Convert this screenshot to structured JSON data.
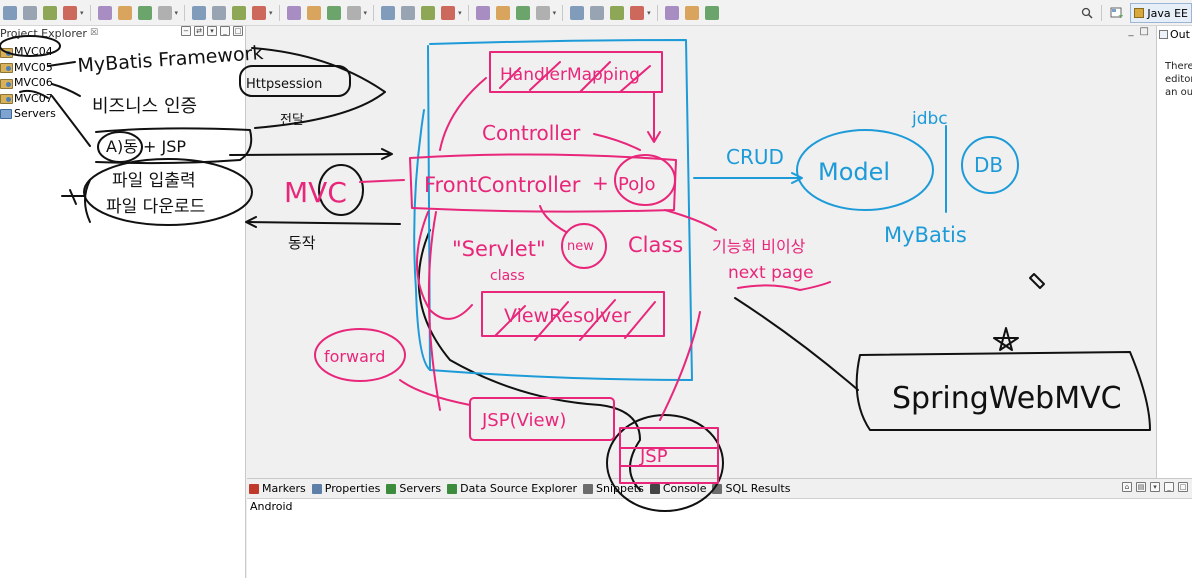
{
  "toolbar": {
    "icons": [
      "new-icon",
      "save-icon",
      "save-all-icon",
      "print-icon",
      "skip-breakpoints-icon",
      "resume-icon",
      "suspend-icon",
      "terminate-icon",
      "disconnect-icon",
      "step-into-icon",
      "step-over-icon",
      "step-return-icon",
      "drop-to-frame-icon",
      "use-step-filters-icon",
      "debug-icon",
      "run-icon",
      "run-last-icon",
      "external-tools-icon",
      "build-icon",
      "new-server-icon",
      "new-package-icon",
      "new-class-icon",
      "open-type-icon",
      "open-task-icon",
      "search-icon",
      "search-menu-icon",
      "annotation-next-icon",
      "annotation-prev-icon",
      "back-icon",
      "forward-icon",
      "pin-editor-icon"
    ],
    "quick_access_icon": "magnifier-icon",
    "open_perspective_icon": "open-perspective-icon",
    "perspective_label": "Java EE"
  },
  "project_explorer": {
    "title": "Project Explorer",
    "close_glyph": "☒",
    "items": [
      {
        "label": "MVC04",
        "icon": "project-icon"
      },
      {
        "label": "MVC05",
        "icon": "project-icon"
      },
      {
        "label": "MVC06",
        "icon": "project-icon"
      },
      {
        "label": "MVC07",
        "icon": "project-icon"
      },
      {
        "label": "Servers",
        "icon": "servers-folder-icon"
      }
    ]
  },
  "outline": {
    "tab_label": "Out",
    "message_lines": [
      "There",
      "editor",
      "an out"
    ]
  },
  "bottom_panel": {
    "tabs": [
      {
        "label": "Markers",
        "icon": "markers-icon",
        "color": "#c0392b"
      },
      {
        "label": "Properties",
        "icon": "properties-icon",
        "color": "#5d7fa8"
      },
      {
        "label": "Servers",
        "icon": "servers-icon",
        "color": "#3d8b3d"
      },
      {
        "label": "Data Source Explorer",
        "icon": "data-source-icon",
        "color": "#3d8b3d"
      },
      {
        "label": "Snippets",
        "icon": "snippets-icon",
        "color": "#6c6c6c"
      },
      {
        "label": "Console",
        "icon": "console-icon",
        "color": "#444444"
      },
      {
        "label": "SQL Results",
        "icon": "sql-results-icon",
        "color": "#6c6c6c"
      }
    ],
    "console_label": "Android"
  },
  "annotations": {
    "black": {
      "mybatis_framework": "MyBatis Framework",
      "httpsession": "Httpsession",
      "korean_line1": "비즈니스 인증",
      "korean_line2": "A)동 + JSP",
      "korean_box1": "파일 입출력",
      "korean_box2": "파일 다운로드",
      "mvc": "MVC",
      "bottom_label": "동작",
      "small_note": "전달",
      "springwebmvc": "SpringWebMVC"
    },
    "pink": {
      "handlermapping": "HandlerMapping",
      "controller": "Controller",
      "frontcontroller": "FrontController",
      "pojo": "PoJo",
      "servlet": "\"Servlet\"",
      "new": "new",
      "class_label": "Class",
      "class_small": "class",
      "korean_next": "기능회 비이상",
      "next_page": "next page",
      "viewresolver": "ViewResolver",
      "forward": "forward",
      "jsp_view": "JSP(View)",
      "jsp_small": "JSP"
    },
    "blue": {
      "crud": "CRUD",
      "model": "Model",
      "jdbc": "jdbc",
      "db": "DB",
      "mybatis": "MyBatis"
    },
    "colors": {
      "pink": "#e8267a",
      "blue": "#1d9bd8",
      "black": "#111111"
    }
  }
}
